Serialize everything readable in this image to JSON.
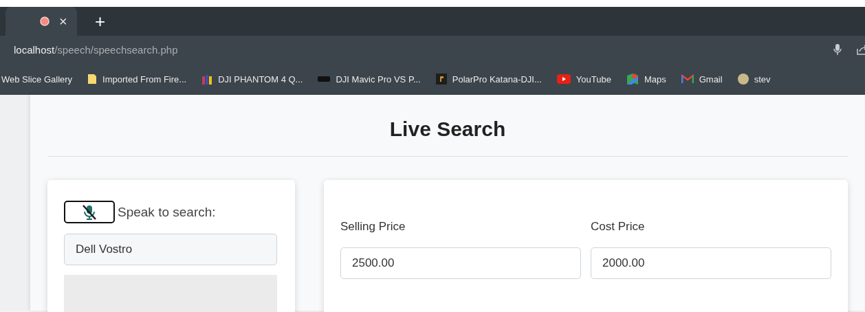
{
  "browser": {
    "tab": {
      "close": "×"
    },
    "new_tab": "+",
    "address": {
      "host": "localhost",
      "path": "/speech/speechsearch.php"
    },
    "bookmarks": [
      {
        "label": "Web Slice Gallery"
      },
      {
        "label": "Imported From Fire..."
      },
      {
        "label": "DJI PHANTOM 4 Q..."
      },
      {
        "label": "DJI Mavic Pro VS P..."
      },
      {
        "label": "PolarPro Katana-DJI..."
      },
      {
        "label": "YouTube"
      },
      {
        "label": "Maps"
      },
      {
        "label": "Gmail"
      },
      {
        "label": "stev"
      }
    ]
  },
  "page": {
    "title": "Live Search",
    "search_card": {
      "mic_muted": true,
      "label": "Speak to search:",
      "value": "Dell Vostro"
    },
    "price_card": {
      "fields": [
        {
          "label": "Selling Price",
          "value": "2500.00"
        },
        {
          "label": "Cost Price",
          "value": "2000.00"
        }
      ]
    }
  }
}
